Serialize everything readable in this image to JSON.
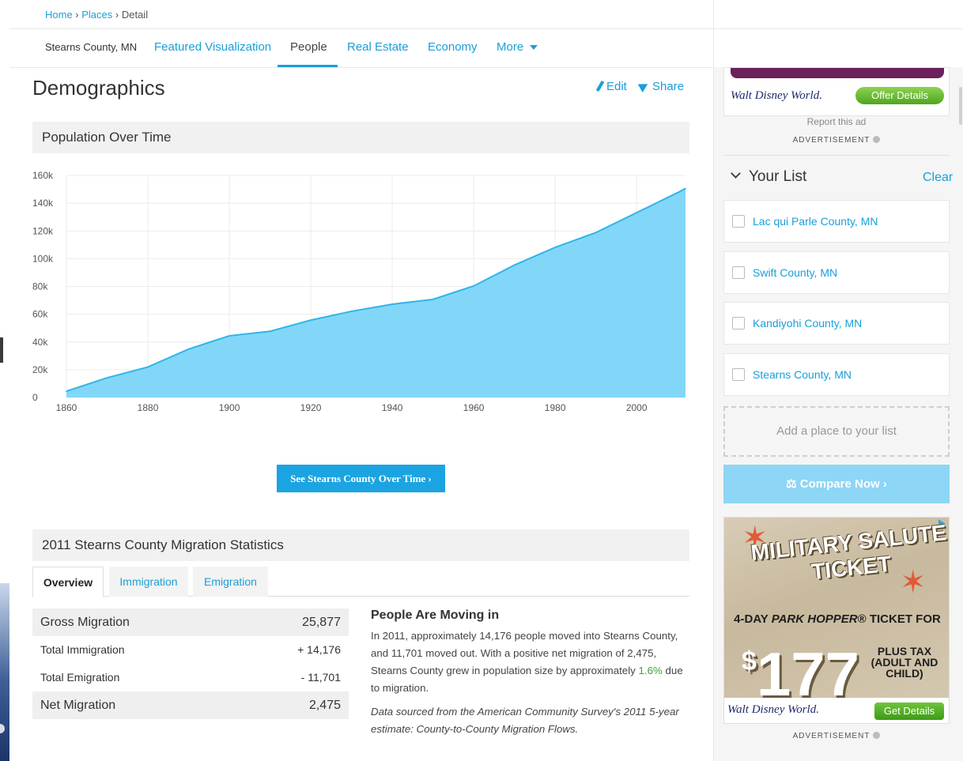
{
  "breadcrumb": {
    "home": "Home",
    "places": "Places",
    "detail": "Detail",
    "sep": " › "
  },
  "subnav": {
    "place": "Stearns County, MN",
    "tabs": [
      "Featured Visualization",
      "People",
      "Real Estate",
      "Economy",
      "More"
    ],
    "active_tab": "People"
  },
  "page": {
    "title": "Demographics",
    "edit": "Edit",
    "share": "Share"
  },
  "population": {
    "heading": "Population Over Time",
    "button": "See Stearns County Over Time ›"
  },
  "chart_data": {
    "type": "area",
    "title": "Population Over Time",
    "x": [
      1860,
      1870,
      1880,
      1890,
      1900,
      1910,
      1920,
      1930,
      1940,
      1950,
      1960,
      1970,
      1980,
      1990,
      2000,
      2010,
      2012
    ],
    "values": [
      4500,
      14200,
      21950,
      34850,
      44450,
      47700,
      55750,
      62100,
      67200,
      70700,
      80350,
      95400,
      108150,
      118800,
      133150,
      147500,
      150600
    ],
    "x_ticks": [
      1860,
      1880,
      1900,
      1920,
      1940,
      1960,
      1980,
      2000
    ],
    "y_ticks": [
      "0",
      "20k",
      "40k",
      "60k",
      "80k",
      "100k",
      "120k",
      "140k",
      "160k"
    ],
    "ylim": [
      0,
      160000
    ],
    "xlim": [
      1860,
      2012
    ],
    "grid": true,
    "colors": {
      "fill": "#82d7f8",
      "line": "#30b4e8",
      "grid": "#ececec"
    }
  },
  "migration": {
    "heading": "2011 Stearns County Migration Statistics",
    "tabs": [
      "Overview",
      "Immigration",
      "Emigration"
    ],
    "active_tab": "Overview",
    "rows": [
      {
        "label": "Gross Migration",
        "value": "25,877"
      },
      {
        "label": "Total Immigration",
        "value": "+ 14,176"
      },
      {
        "label": "Total Emigration",
        "value": "- 11,701"
      },
      {
        "label": "Net Migration",
        "value": "2,475"
      }
    ],
    "summary": {
      "title": "People Are Moving in",
      "text_before": "In 2011, approximately 14,176 people moved into Stearns County, and 11,701 moved out. With a positive net migration of 2,475, Stearns County grew in population size by approximately ",
      "pct": "1.6%",
      "text_after": " due to migration.",
      "source": "Data sourced from the American Community Survey's 2011 5-year estimate: County-to-County Migration Flows."
    }
  },
  "sidebar": {
    "ad_top": {
      "brand": "Walt Disney World.",
      "button": "Offer Details",
      "report": "Report this ad"
    },
    "advertisement_label": "ADVERTISEMENT",
    "list": {
      "title": "Your List",
      "clear": "Clear",
      "items": [
        "Lac qui Parle County, MN",
        "Swift County, MN",
        "Kandiyohi County, MN",
        "Stearns County, MN"
      ],
      "add": "Add a place to your list",
      "compare": "Compare Now"
    },
    "ad_bottom": {
      "headline": "MILITARY SALUTE TICKET",
      "ticket_for_a": "4-DAY ",
      "ticket_for_b": "PARK HOPPER",
      "ticket_for_c": "® TICKET FOR",
      "price_symbol": "$",
      "price": "177",
      "tax": "PLUS TAX (ADULT AND CHILD)",
      "brand": "Walt Disney World.",
      "button": "Get Details"
    }
  }
}
